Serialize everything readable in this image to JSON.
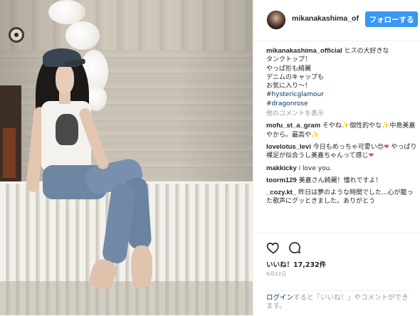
{
  "post": {
    "username": "mikanakashima_of",
    "follow_label": "フォローする"
  },
  "caption": {
    "username": "mikanakashima_official",
    "lines": [
      "ヒスの大好きな",
      "タンクトップ！",
      "やっぱ形も綺麗",
      "デニムのキャップも",
      "お気に入り〜！"
    ],
    "hashtags": [
      "#hystericglamour",
      "#dragonrose"
    ]
  },
  "more_comments_label": "他のコメントを表示",
  "comments": [
    {
      "user": "mofu_st_a_gram",
      "text_a": "そやね",
      "text_b": "個性的やな",
      "text_c": "中島美嘉やから。最高や"
    },
    {
      "user": "lovelotus_levi",
      "text_a": "今日もめっちゃ可愛い",
      "text_b": "やっぱり裸足が似合うし美嘉ちゃんって感じ"
    },
    {
      "user": "makkicky",
      "text_a": "i love you."
    },
    {
      "user": "toorm129",
      "text_a": "美嘉さん綺麗！憧れですよ！"
    },
    {
      "user": "_cozy.kt_",
      "text_a": "昨日は夢のような時間でした...心が籠った歌声にグッときました。ありがとう"
    }
  ],
  "actions": {
    "heart_icon": "heart-outline-icon",
    "comment_icon": "comment-bubble-icon"
  },
  "likes_text": "いいね！17,232件",
  "date_text": "6月22日",
  "login": {
    "link_label": "ログイン",
    "text": "すると「いいね！」やコメントができます。"
  }
}
